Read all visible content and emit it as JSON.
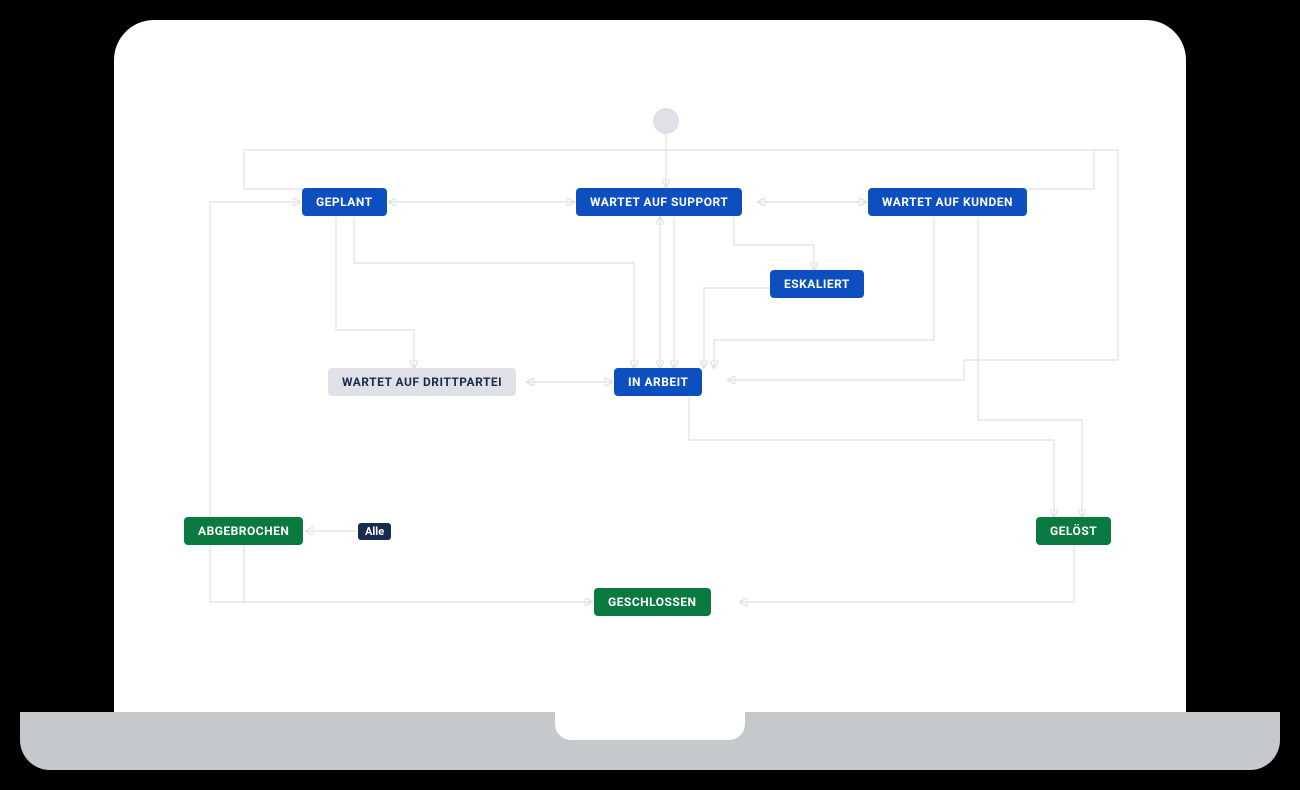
{
  "nodes": {
    "geplant": "GEPLANT",
    "wartet_support": "WARTET AUF SUPPORT",
    "wartet_kunden": "WARTET AUF KUNDEN",
    "eskaliert": "ESKALIERT",
    "wartet_dritt": "WARTET AUF DRITTPARTEI",
    "in_arbeit": "IN ARBEIT",
    "abgebrochen": "ABGEBROCHEN",
    "geloest": "GELÖST",
    "geschlossen": "GESCHLOSSEN"
  },
  "chip": {
    "alle": "Alle"
  },
  "colors": {
    "blue": "#0e4fbf",
    "green": "#0b7a41",
    "grey": "#dfe1e6",
    "dark": "#172b4d",
    "edge": "#dfe1e6"
  },
  "edges": [
    {
      "from": "start",
      "to": "wartet_support"
    },
    {
      "from": "start",
      "to": "geplant",
      "via": "top-left"
    },
    {
      "from": "start",
      "to": "wartet_kunden",
      "via": "top-right"
    },
    {
      "from": "start",
      "to": "in_arbeit",
      "via": "far-right-down"
    },
    {
      "from": "wartet_support",
      "to": "geplant",
      "bidir": true
    },
    {
      "from": "wartet_support",
      "to": "wartet_kunden",
      "bidir": true
    },
    {
      "from": "wartet_support",
      "to": "eskaliert"
    },
    {
      "from": "wartet_support",
      "to": "in_arbeit",
      "bidir": true
    },
    {
      "from": "geplant",
      "to": "wartet_dritt"
    },
    {
      "from": "geplant",
      "to": "in_arbeit",
      "via": "down-right"
    },
    {
      "from": "eskaliert",
      "to": "in_arbeit"
    },
    {
      "from": "wartet_kunden",
      "to": "in_arbeit",
      "via": "down-left"
    },
    {
      "from": "wartet_kunden",
      "to": "geloest"
    },
    {
      "from": "wartet_dritt",
      "to": "in_arbeit",
      "bidir": true
    },
    {
      "from": "in_arbeit",
      "to": "geloest",
      "via": "down-right"
    },
    {
      "from": "alle",
      "to": "abgebrochen"
    },
    {
      "from": "abgebrochen",
      "to": "geschlossen",
      "via": "down-right"
    },
    {
      "from": "geloest",
      "to": "geschlossen",
      "via": "down-left"
    },
    {
      "from": "geschlossen",
      "to": "wartet_support",
      "via": "far-left-up"
    }
  ]
}
